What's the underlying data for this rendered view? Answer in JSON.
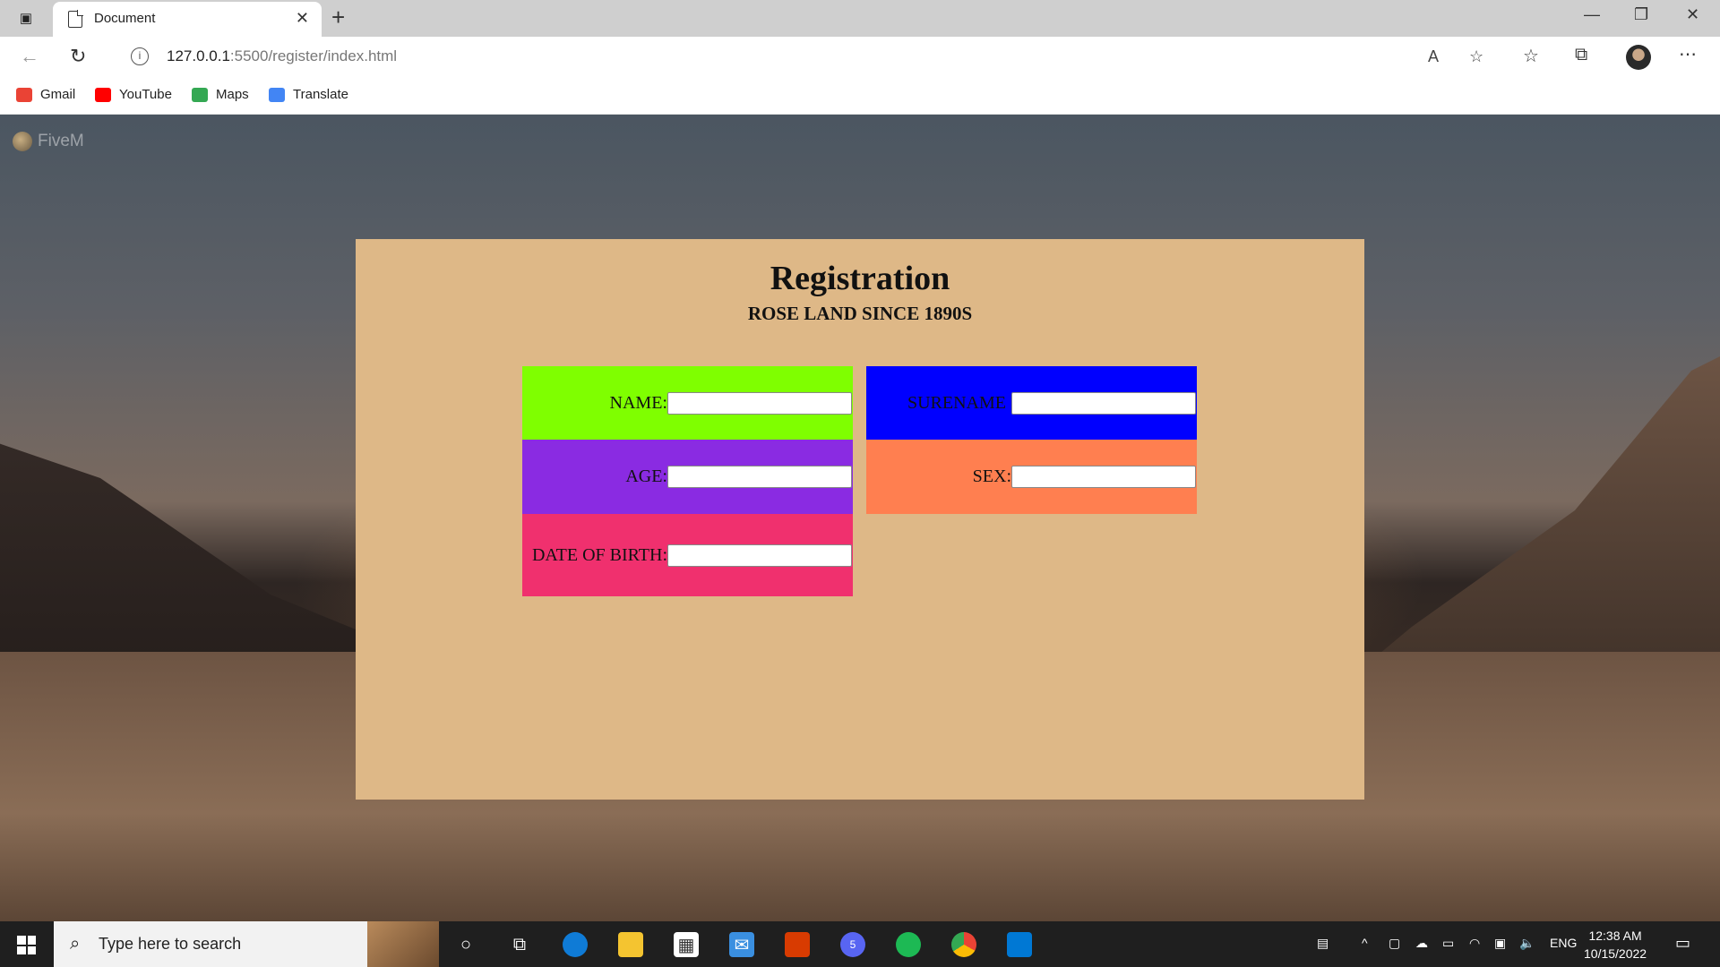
{
  "browser": {
    "tab_title": "Document",
    "tab_close": "✕",
    "new_tab": "+",
    "url_host": "127.0.0.1",
    "url_path": ":5500/register/index.html",
    "window_minimize": "—",
    "window_restore": "❐",
    "window_close": "✕"
  },
  "bookmarks": [
    {
      "label": "Gmail",
      "color": "#ea4335"
    },
    {
      "label": "YouTube",
      "color": "#ff0000"
    },
    {
      "label": "Maps",
      "color": "#34a853"
    },
    {
      "label": "Translate",
      "color": "#4285f4"
    }
  ],
  "overlay": {
    "label": "FiveM"
  },
  "form": {
    "title": "Registration",
    "subtitle": "ROSE LAND SINCE 1890S",
    "fields": {
      "name": {
        "label": "NAME:",
        "value": "",
        "color": "#7fff00"
      },
      "surname": {
        "label": "SURENAME",
        "value": "",
        "color": "#0000ff"
      },
      "age": {
        "label": "AGE:",
        "value": "",
        "color": "#8a2be2"
      },
      "sex": {
        "label": "SEX:",
        "value": "",
        "color": "#ff7f50"
      },
      "dob": {
        "label": "DATE OF BIRTH:",
        "value": "",
        "color": "#f0306e"
      }
    },
    "card_color": "#deb887"
  },
  "taskbar": {
    "search_placeholder": "Type here to search",
    "language": "ENG",
    "time": "12:38 AM",
    "date": "10/15/2022",
    "discord_badge": "5"
  }
}
